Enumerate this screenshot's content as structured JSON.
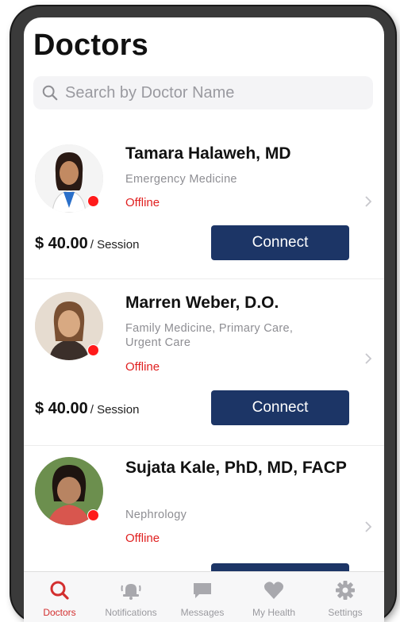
{
  "header": {
    "title": "Doctors"
  },
  "search": {
    "placeholder": "Search by Doctor Name"
  },
  "doctors": [
    {
      "name": "Tamara Halaweh, MD",
      "specialty": "Emergency Medicine",
      "status": "Offline",
      "price": "$ 40.00",
      "price_unit": "/ Session",
      "button": "Connect"
    },
    {
      "name": "Marren Weber, D.O.",
      "specialty": "Family Medicine, Primary Care, Urgent Care",
      "status": "Offline",
      "price": "$ 40.00",
      "price_unit": "/ Session",
      "button": "Connect"
    },
    {
      "name": "Sujata Kale, PhD, MD, FACP",
      "specialty": "Nephrology",
      "status": "Offline"
    }
  ],
  "tabs": [
    {
      "label": "Doctors",
      "icon": "search-icon",
      "active": true
    },
    {
      "label": "Notifications",
      "icon": "bell-icon"
    },
    {
      "label": "Messages",
      "icon": "chat-icon"
    },
    {
      "label": "My Health",
      "icon": "heart-icon"
    },
    {
      "label": "Settings",
      "icon": "gear-icon"
    }
  ],
  "colors": {
    "accent": "#1c3566",
    "status_offline": "#e02020",
    "tab_active": "#d32f2f"
  }
}
